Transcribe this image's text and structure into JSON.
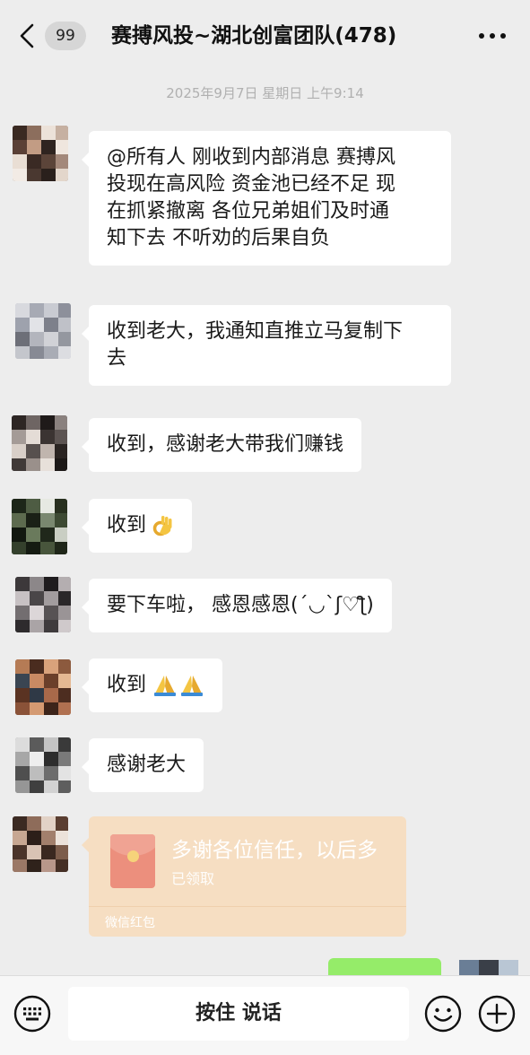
{
  "header": {
    "badge": "99",
    "title": "赛搏风投~湖北创富团队(478)"
  },
  "timestamp": "2025年9月7日 星期日 上午9:14",
  "messages": [
    {
      "lines": [
        "@所有人 刚收到内部消息 赛搏风",
        "投现在高风险 资金池已经不足 现",
        "在抓紧撤离 各位兄弟姐们及时通",
        "知下去 不听劝的后果自负"
      ]
    },
    {
      "lines": [
        "收到老大，我通知直推立马复制下",
        "去"
      ]
    },
    {
      "text": "收到，感谢老大带我们赚钱"
    },
    {
      "text": "收到",
      "emoji": "ok-hand-icon"
    },
    {
      "text": "要下车啦， 感恩感恩(´◡`ʃ♡ƪ)"
    },
    {
      "text": "收到",
      "emoji": "folded-hands-icon"
    },
    {
      "text": "感谢老大"
    }
  ],
  "red_packet": {
    "title": "多谢各位信任，以后多",
    "status": "已领取",
    "footer": "微信红包"
  },
  "input": {
    "voice_label": "按住 说话"
  },
  "colors": {
    "background": "#ededed",
    "bubble": "#ffffff",
    "red_packet": "#f6dec2",
    "own_bubble": "#95ec69"
  }
}
